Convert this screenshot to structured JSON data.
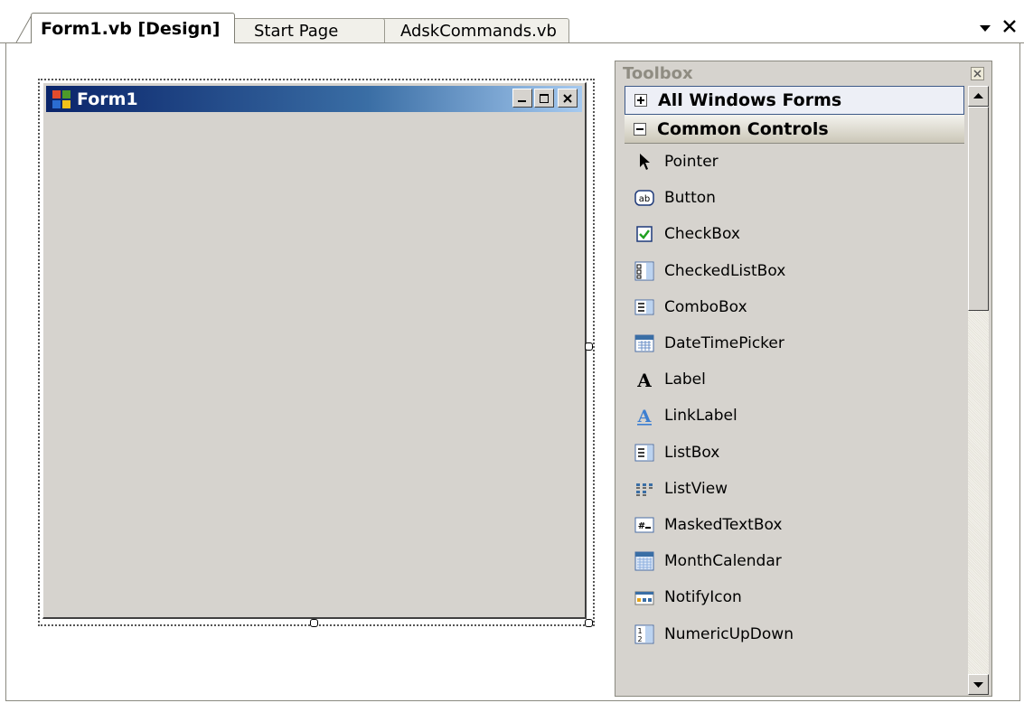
{
  "tabs": [
    {
      "label": "Form1.vb [Design]",
      "active": true
    },
    {
      "label": "Start Page",
      "active": false
    },
    {
      "label": "AdskCommands.vb",
      "active": false
    }
  ],
  "tab_actions": {
    "dropdown_icon": "chevron-down-icon",
    "close_icon": "close-icon"
  },
  "form": {
    "title": "Form1",
    "caption_buttons": [
      "minimize",
      "maximize",
      "close"
    ]
  },
  "toolbox": {
    "title": "Toolbox",
    "categories": [
      {
        "label": "All Windows Forms",
        "expanded": false
      },
      {
        "label": "Common Controls",
        "expanded": true
      }
    ],
    "items": [
      {
        "label": "Pointer",
        "icon": "pointer-icon"
      },
      {
        "label": "Button",
        "icon": "button-icon"
      },
      {
        "label": "CheckBox",
        "icon": "checkbox-icon"
      },
      {
        "label": "CheckedListBox",
        "icon": "checkedlistbox-icon"
      },
      {
        "label": "ComboBox",
        "icon": "combobox-icon"
      },
      {
        "label": "DateTimePicker",
        "icon": "datetimepicker-icon"
      },
      {
        "label": "Label",
        "icon": "label-icon"
      },
      {
        "label": "LinkLabel",
        "icon": "linklabel-icon"
      },
      {
        "label": "ListBox",
        "icon": "listbox-icon"
      },
      {
        "label": "ListView",
        "icon": "listview-icon"
      },
      {
        "label": "MaskedTextBox",
        "icon": "maskedtextbox-icon"
      },
      {
        "label": "MonthCalendar",
        "icon": "monthcalendar-icon"
      },
      {
        "label": "NotifyIcon",
        "icon": "notifyicon-icon"
      },
      {
        "label": "NumericUpDown",
        "icon": "numericupdown-icon"
      }
    ]
  },
  "colors": {
    "form_background": "#d6d3ce",
    "titlebar_start": "#0a246a",
    "titlebar_end": "#a6caf0",
    "toolbox_background": "#d6d3ce",
    "category_border": "#3d5987"
  }
}
